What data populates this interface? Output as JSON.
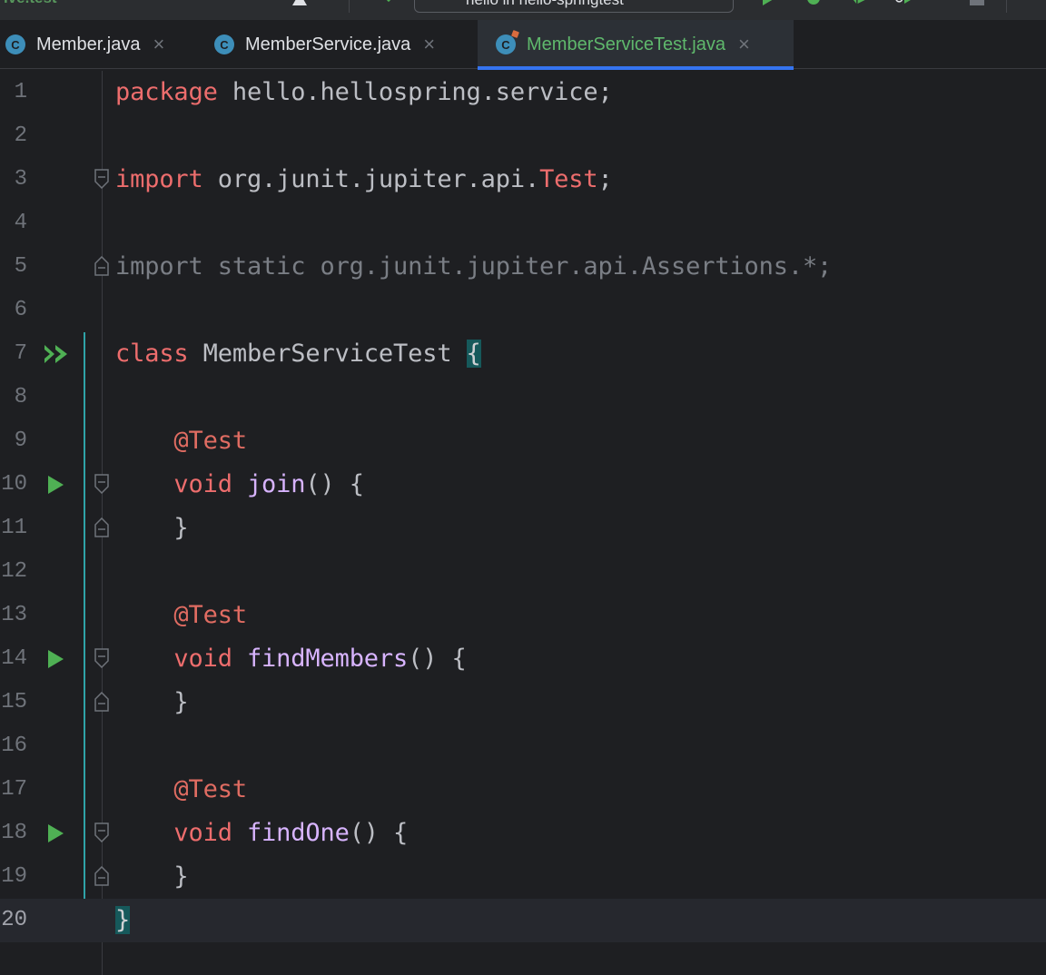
{
  "toolbar": {
    "project_name": "ive.test",
    "run_config": "hello in hello-springtest"
  },
  "tabs": [
    {
      "label": "Member.java",
      "icon": "C",
      "close": "×"
    },
    {
      "label": "MemberService.java",
      "icon": "C",
      "close": "×"
    },
    {
      "label": "MemberServiceTest.java",
      "icon": "C",
      "close": "×",
      "active": true
    }
  ],
  "editor": {
    "lines": [
      {
        "n": "1"
      },
      {
        "n": "2"
      },
      {
        "n": "3"
      },
      {
        "n": "4"
      },
      {
        "n": "5"
      },
      {
        "n": "6"
      },
      {
        "n": "7"
      },
      {
        "n": "8"
      },
      {
        "n": "9"
      },
      {
        "n": "10"
      },
      {
        "n": "11"
      },
      {
        "n": "12"
      },
      {
        "n": "13"
      },
      {
        "n": "14"
      },
      {
        "n": "15"
      },
      {
        "n": "16"
      },
      {
        "n": "17"
      },
      {
        "n": "18"
      },
      {
        "n": "19"
      },
      {
        "n": "20"
      }
    ],
    "code": {
      "l1_kw": "package",
      "l1_rest": " hello.hellospring.service;",
      "l3_kw": "import",
      "l3_mid": " org.junit.jupiter.api.",
      "l3_cls": "Test",
      "l3_end": ";",
      "l5": "import static org.junit.jupiter.api.Assertions.*;",
      "l7_kw": "class",
      "l7_name": " MemberServiceTest ",
      "l7_brace": "{",
      "l9": "@Test",
      "l10_kw": "void",
      "l10_fn": "join",
      "l10_end": "() {",
      "l11": "}",
      "l13": "@Test",
      "l14_kw": "void",
      "l14_fn": "findMembers",
      "l14_end": "() {",
      "l15": "}",
      "l17": "@Test",
      "l18_kw": "void",
      "l18_fn": "findOne",
      "l18_end": "() {",
      "l19": "}",
      "l20": "}"
    }
  },
  "colors": {
    "background": "#1e1f22",
    "keyword": "#cf8e6d",
    "annotation": "#e06c62",
    "method": "#d8b4ff",
    "run_icon": "#4fb054",
    "active_tab_text": "#5fb86c",
    "scope_bar": "#2fa3a8"
  }
}
